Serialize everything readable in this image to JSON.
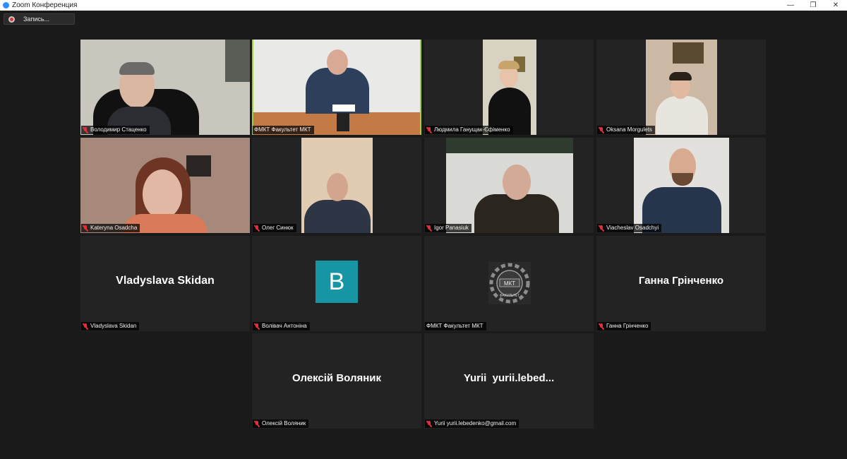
{
  "window": {
    "title": "Zoom Конференция",
    "minimize": "—",
    "restore": "❐",
    "close": "✕"
  },
  "recording": {
    "label": "Запись..."
  },
  "tiles": [
    {
      "name": "Володимир Стаценко",
      "muted": true
    },
    {
      "name": "ФМКТ Факультет МКТ",
      "muted": false,
      "active": true
    },
    {
      "name": "Людмила Ганущак-Єфіменко",
      "muted": true
    },
    {
      "name": "Oksana Morgulets",
      "muted": true
    },
    {
      "name": "Kateryna Osadcha",
      "muted": true
    },
    {
      "name": "Олег Синюк",
      "muted": true
    },
    {
      "name": "Igor Panasiuk",
      "muted": true
    },
    {
      "name": "Viacheslav Osadchyi",
      "muted": true
    },
    {
      "name": "Vladyslava Skidan",
      "muted": true,
      "display": "Vladyslava Skidan"
    },
    {
      "name": "Волівач Антоніна",
      "muted": true,
      "avatar_letter": "B"
    },
    {
      "name": "ФМКТ Факультет МКТ",
      "muted": false,
      "logo_text": "МКТ",
      "logo_subtext": "ФАКУЛЬТЕТ"
    },
    {
      "name": "Ганна Грінченко",
      "muted": true,
      "display": "Ганна Грінченко"
    },
    {
      "name": "Олексій Воляник",
      "muted": true,
      "display": "Олексій Воляник"
    },
    {
      "name": "Yurii yurii.lebedenko@gmail.com",
      "muted": true,
      "display": "Yurii  yurii.lebed..."
    }
  ],
  "colors": {
    "active_border": "#9bd13a",
    "avatar_bg": "#1795a5",
    "muted_icon": "#e0313a"
  }
}
